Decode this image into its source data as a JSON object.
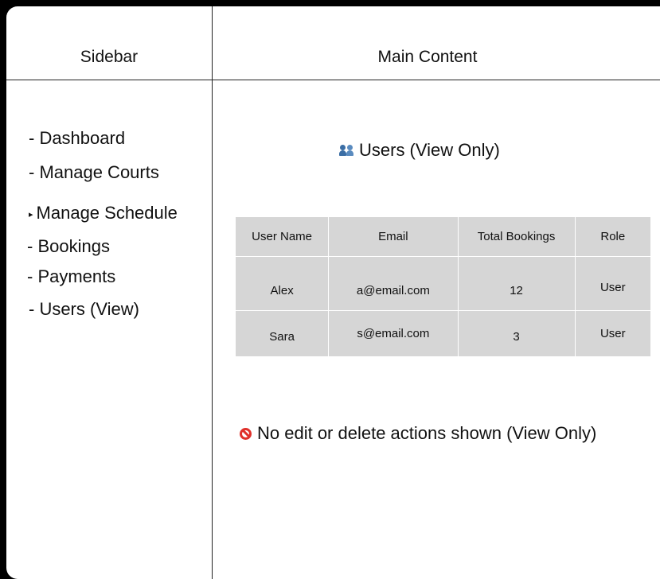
{
  "layout_labels": {
    "sidebar": "Sidebar",
    "main": "Main Content"
  },
  "sidebar": {
    "items": [
      {
        "label": "- Dashboard"
      },
      {
        "label": "- Manage Courts"
      },
      {
        "label": "Manage Schedule",
        "marker": "▸"
      },
      {
        "label": "- Bookings"
      },
      {
        "label": "- Payments"
      },
      {
        "label": "- Users (View)"
      }
    ]
  },
  "main": {
    "heading": "Users (View Only)",
    "heading_icon": "users-icon",
    "table": {
      "headers": [
        "User Name",
        "Email",
        "Total Bookings",
        "Role"
      ],
      "rows": [
        [
          "Alex",
          "a@email.com",
          "12",
          "User"
        ],
        [
          "Sara",
          "s@email.com",
          "3",
          "User"
        ]
      ]
    },
    "notice": "No edit or delete actions shown (View Only)",
    "notice_icon": "prohibited-icon"
  },
  "colors": {
    "background": "#000000",
    "panel": "#ffffff",
    "table_fill": "#d6d6d6",
    "prohibited": "#e0312b"
  }
}
